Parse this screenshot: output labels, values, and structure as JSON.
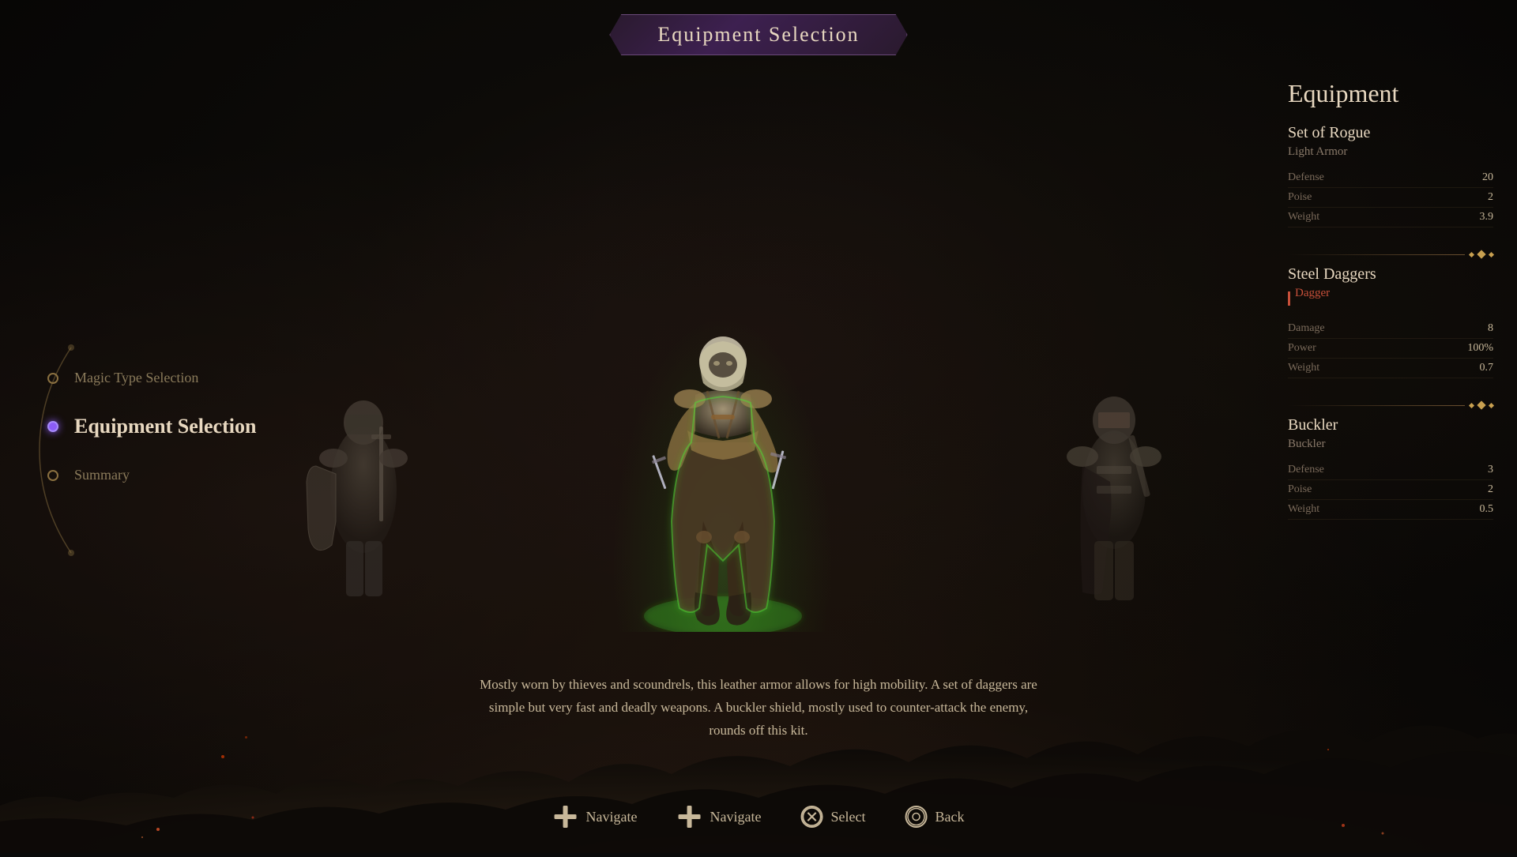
{
  "title": "Equipment Selection",
  "nav": {
    "items": [
      {
        "id": "magic-type",
        "label": "Magic Type Selection",
        "active": false
      },
      {
        "id": "equipment",
        "label": "Equipment Selection",
        "active": true
      },
      {
        "id": "summary",
        "label": "Summary",
        "active": false
      }
    ]
  },
  "equipment_panel": {
    "title": "Equipment",
    "sections": [
      {
        "id": "armor",
        "name": "Set of Rogue",
        "type": "Light Armor",
        "type_accent": false,
        "stats": [
          {
            "label": "Defense",
            "value": "20"
          },
          {
            "label": "Poise",
            "value": "2"
          },
          {
            "label": "Weight",
            "value": "3.9"
          }
        ]
      },
      {
        "id": "weapon",
        "name": "Steel Daggers",
        "type": "Dagger",
        "type_accent": true,
        "stats": [
          {
            "label": "Damage",
            "value": "8"
          },
          {
            "label": "Power",
            "value": "100%"
          },
          {
            "label": "Weight",
            "value": "0.7"
          }
        ]
      },
      {
        "id": "shield",
        "name": "Buckler",
        "type": "Buckler",
        "type_accent": false,
        "stats": [
          {
            "label": "Defense",
            "value": "3"
          },
          {
            "label": "Poise",
            "value": "2"
          },
          {
            "label": "Weight",
            "value": "0.5"
          }
        ]
      }
    ]
  },
  "description": "Mostly worn by thieves and scoundrels, this leather armor allows for high mobility. A set of daggers\nare simple but very fast and deadly weapons. A buckler shield, mostly used to counter-attack the\nenemy, rounds off this kit.",
  "controls": [
    {
      "id": "navigate-left",
      "icon": "dpad",
      "label": "Navigate"
    },
    {
      "id": "navigate-right",
      "icon": "dpad",
      "label": "Navigate"
    },
    {
      "id": "select",
      "icon": "x",
      "label": "Select"
    },
    {
      "id": "back",
      "icon": "circle",
      "label": "Back"
    }
  ]
}
